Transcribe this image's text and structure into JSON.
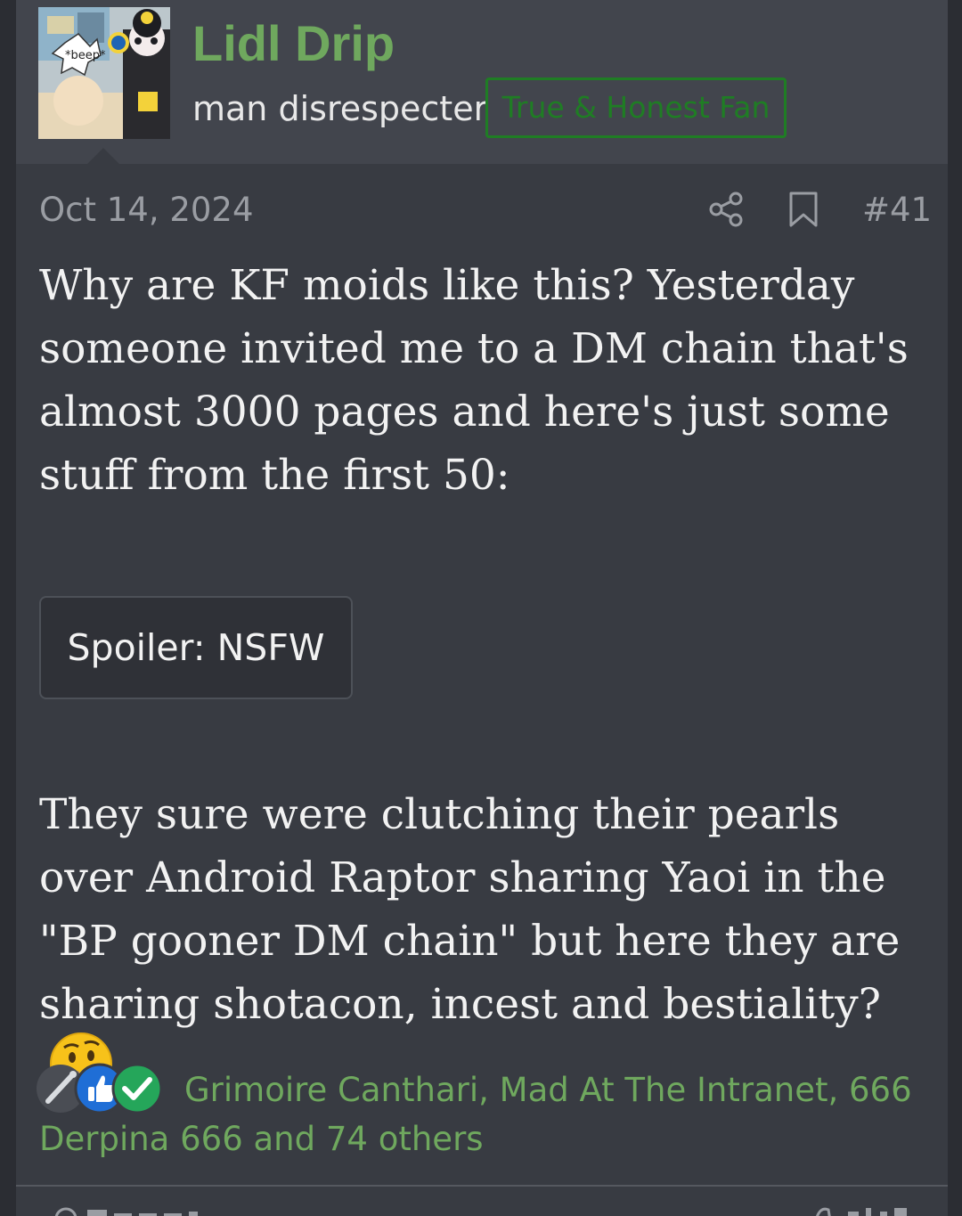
{
  "author": {
    "username": "Lidl Drip",
    "user_title": "man disrespecter",
    "user_banner": "True & Honest Fan",
    "avatar_text": "*beep*"
  },
  "post": {
    "date": "Oct 14, 2024",
    "number": "#41",
    "paragraph_1": "Why are KF moids like this? Yesterday someone invited me to a DM chain that's almost 3000 pages and here's just some stuff from the first 50:",
    "spoiler_label": "Spoiler: NSFW",
    "paragraph_2": "They sure were clutching their pearls over Android Raptor sharing Yaoi in the \"BP gooner DM chain\" but here they are sharing shotacon, incest and bestiality?"
  },
  "reactions": {
    "text": "Grimoire Canthari, Mad At The Intranet, 666 Derpina 666 and 74 others",
    "icons": [
      "syringe-icon",
      "thumbs-up-icon",
      "check-icon"
    ]
  },
  "icons": {
    "share": "share-icon",
    "bookmark": "bookmark-icon",
    "emoji": "thinking-face-emoji"
  },
  "colors": {
    "username": "#6fa85e",
    "banner": "#1f7d24",
    "background": "#383b42",
    "header": "#42454d"
  }
}
